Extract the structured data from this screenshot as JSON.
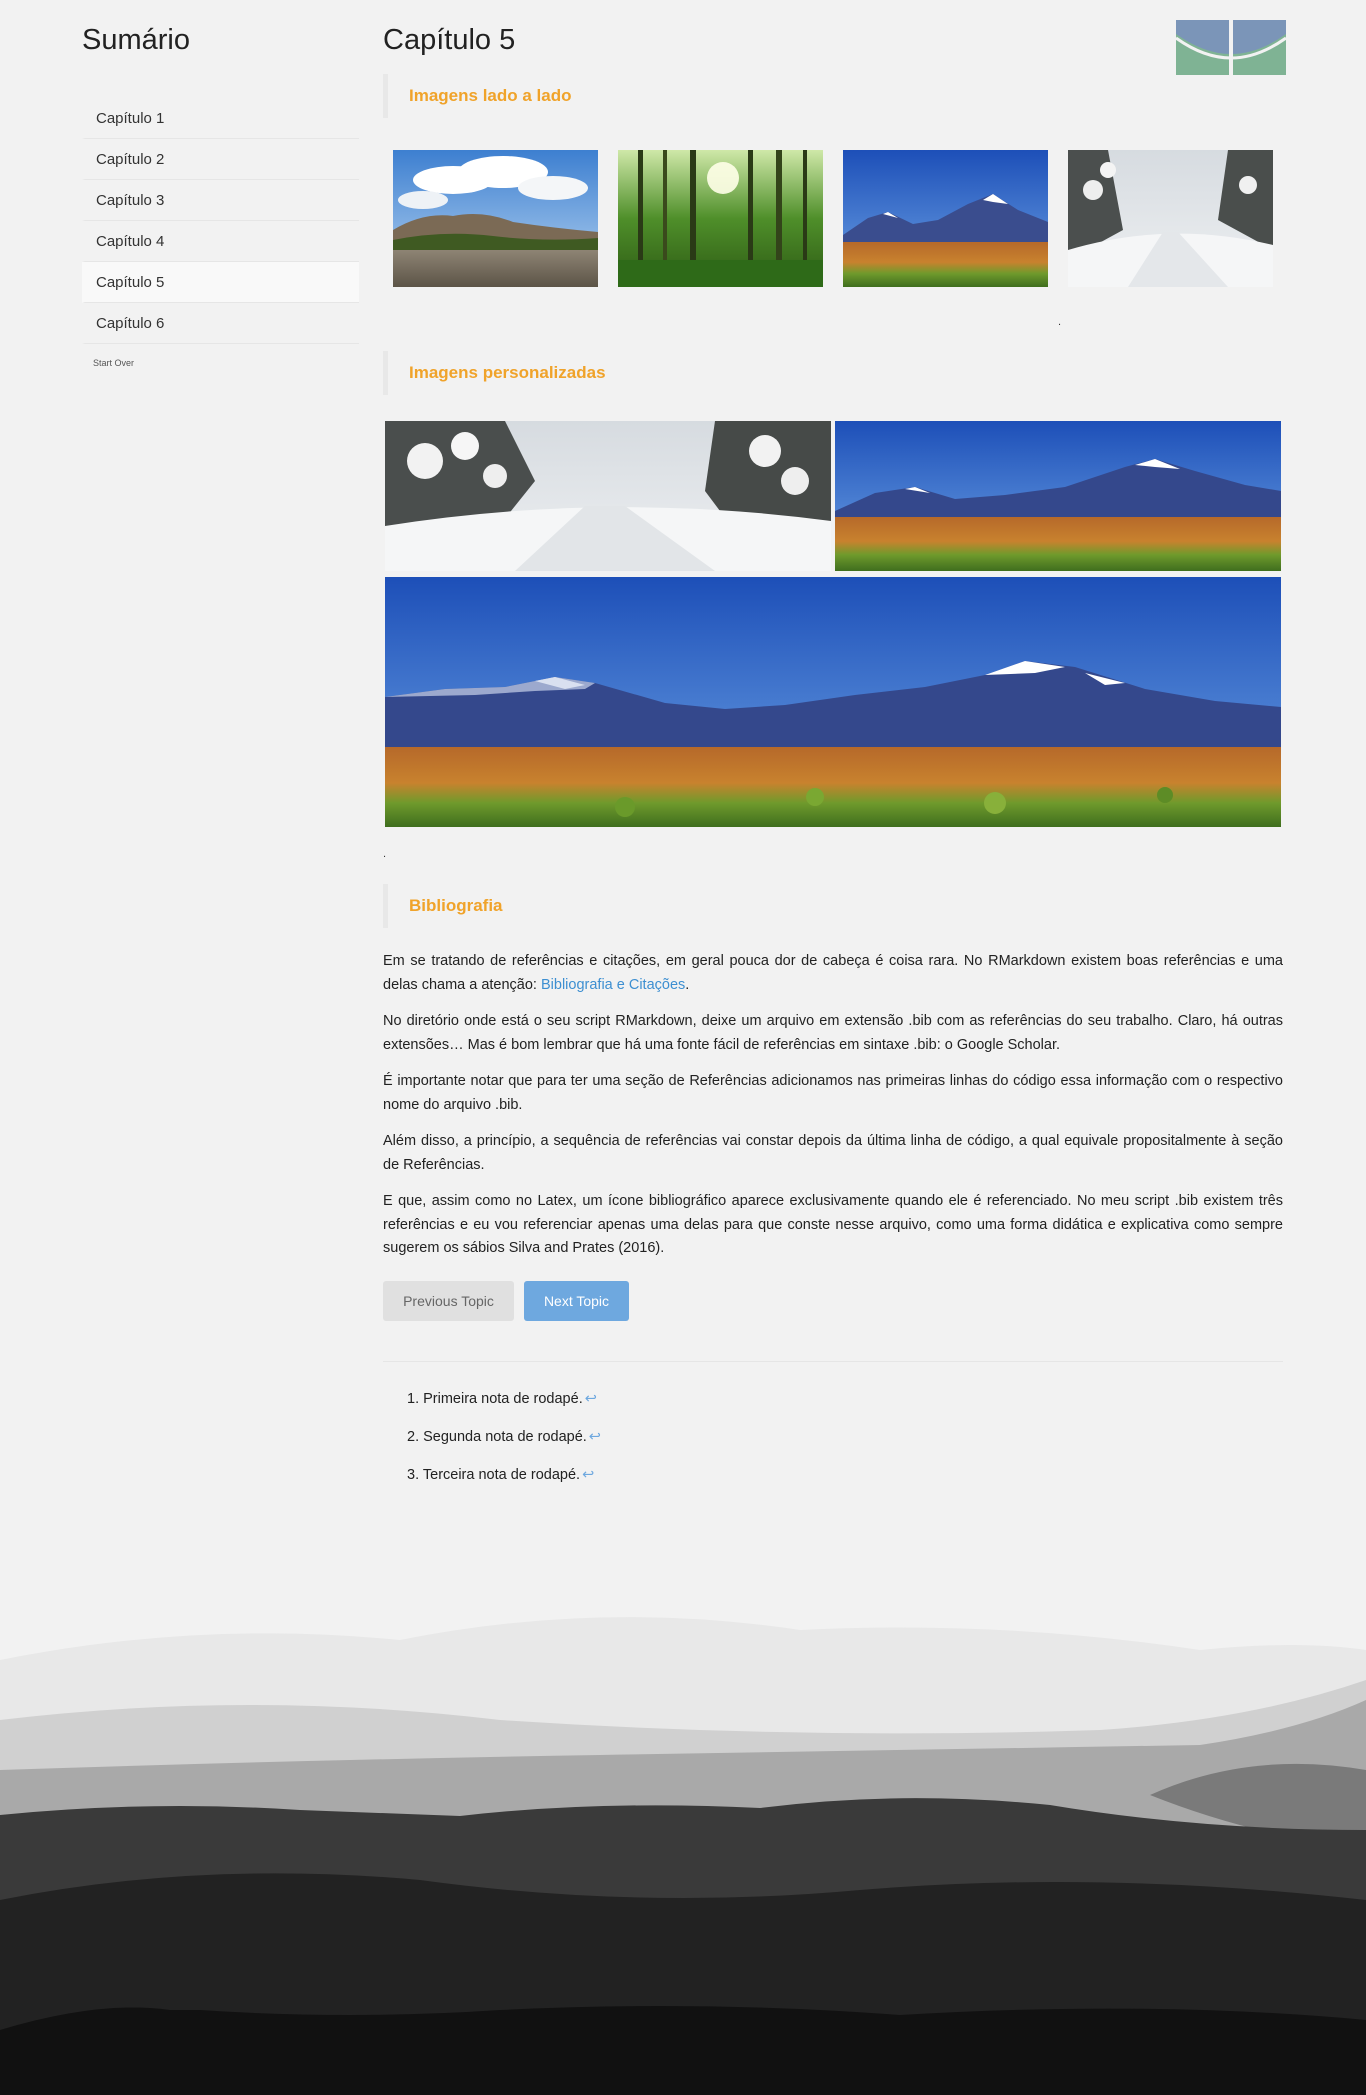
{
  "sidebar": {
    "title": "Sumário",
    "items": [
      {
        "label": "Capítulo 1"
      },
      {
        "label": "Capítulo 2"
      },
      {
        "label": "Capítulo 3"
      },
      {
        "label": "Capítulo 4"
      },
      {
        "label": "Capítulo 5"
      },
      {
        "label": "Capítulo 6"
      }
    ],
    "active_index": 4,
    "start_over": "Start Over"
  },
  "page": {
    "title": "Capítulo 5"
  },
  "logo": {
    "icon": "university-logo-icon",
    "colors": [
      "#7b95b8",
      "#7fb394"
    ]
  },
  "sections": {
    "side_by_side": {
      "heading": "Imagens lado a lado",
      "caption_dot": "."
    },
    "custom": {
      "heading": "Imagens personalizadas",
      "caption_dot": "."
    },
    "bibliography": {
      "heading": "Bibliografia",
      "paragraphs": {
        "p1_text": "Em se tratando de referências e citações, em geral pouca dor de cabeça é coisa rara. No RMarkdown existem boas referências e uma delas chama a atenção: ",
        "p1_link": "Bibliografia e Citações",
        "p1_end": ".",
        "p2": "No diretório onde está o seu script RMarkdown, deixe um arquivo em extensão .bib com as referências do seu trabalho. Claro, há outras extensões… Mas é bom lembrar que há uma fonte fácil de referências em sintaxe .bib: o Google Scholar.",
        "p3": "É importante notar que para ter uma seção de Referências adicionamos nas primeiras linhas do código essa informação com o respectivo nome do arquivo .bib.",
        "p4": "Além disso, a princípio, a sequência de referências vai constar depois da última linha de código, a qual equivale propositalmente à seção de Referências.",
        "p5": "E que, assim como no Latex, um ícone bibliográfico aparece exclusivamente quando ele é referenciado. No meu script .bib existem três referências e eu vou referenciar apenas uma delas para que conste nesse arquivo, como uma forma didática e explicativa como sempre sugerem os sábios Silva and Prates (2016)."
      }
    }
  },
  "navigation": {
    "previous": "Previous Topic",
    "next": "Next Topic"
  },
  "footnotes": [
    {
      "num": "1.",
      "text": "Primeira nota de rodapé.",
      "back": "↩"
    },
    {
      "num": "2.",
      "text": "Segunda nota de rodapé.",
      "back": "↩"
    },
    {
      "num": "3.",
      "text": "Terceira nota de rodapé.",
      "back": "↩"
    }
  ],
  "images": {
    "row": [
      "river-landscape-image",
      "forest-sunlight-image",
      "volcano-mountains-image",
      "snowy-road-image"
    ],
    "custom": [
      "snowy-road-image",
      "volcano-mountains-image",
      "volcano-mountains-large-image"
    ]
  },
  "colors": {
    "accent_heading": "#f0a32a",
    "link": "#3d8fd1",
    "next_button": "#6ea8df",
    "background": "#f2f2f2"
  }
}
